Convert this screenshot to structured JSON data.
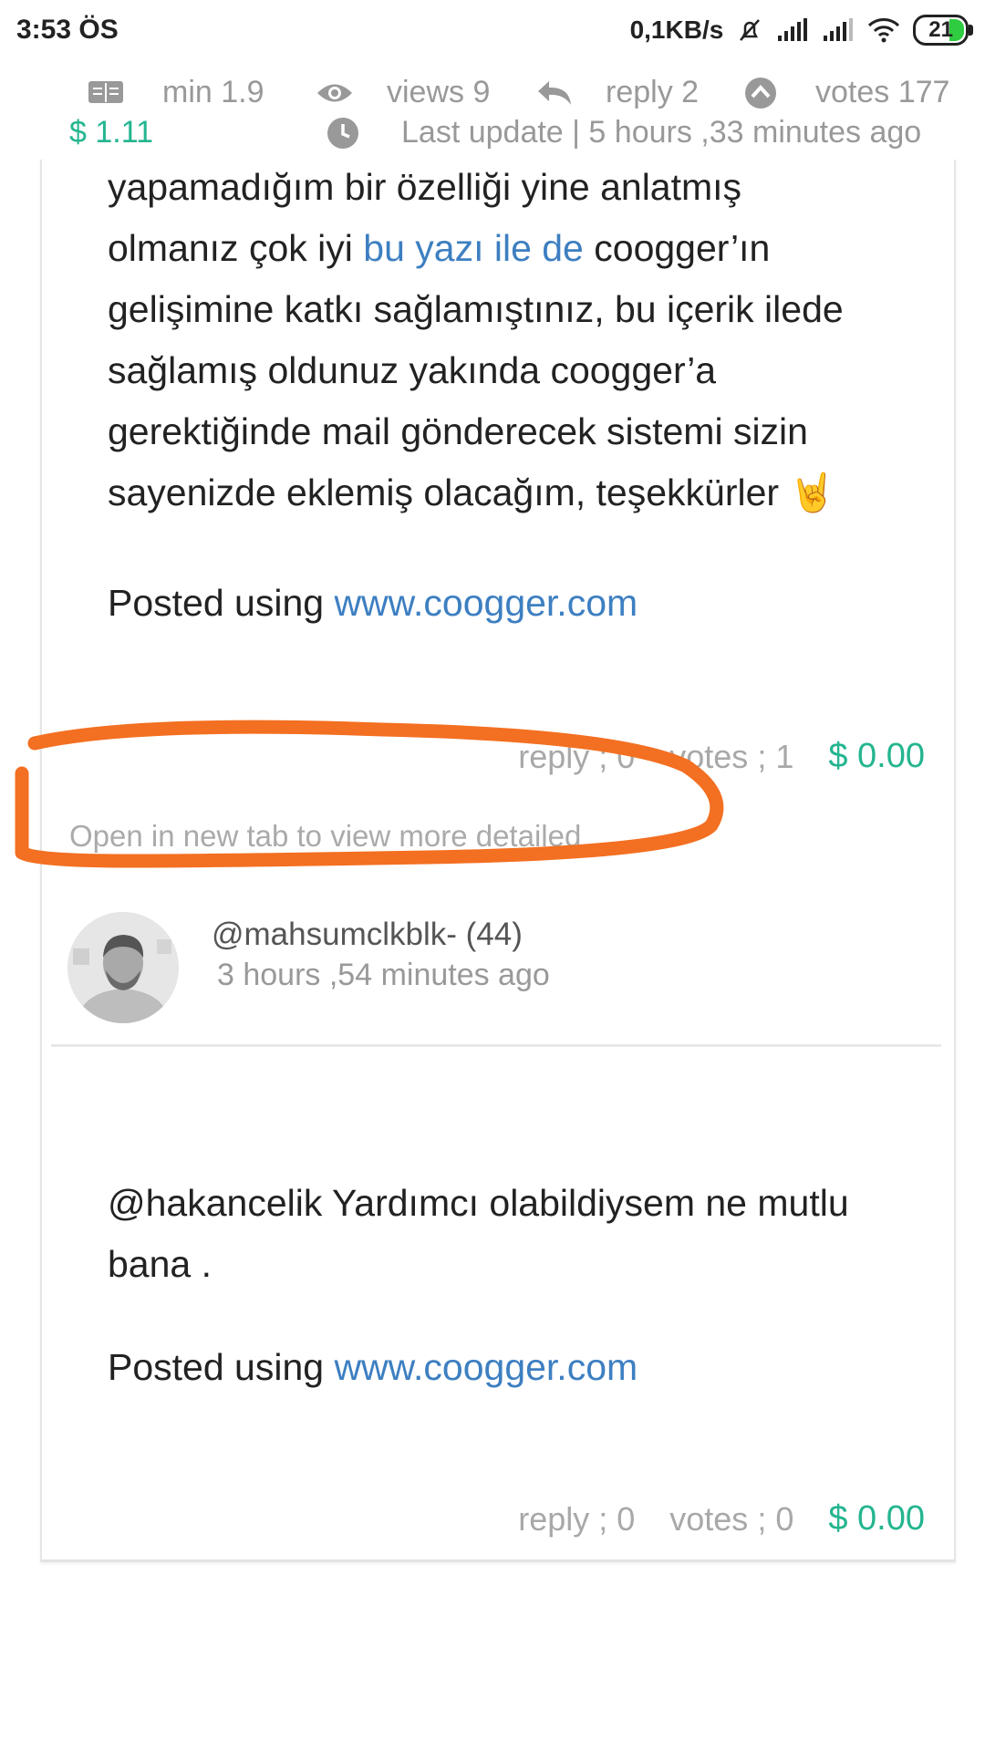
{
  "status_bar": {
    "time": "3:53 ÖS",
    "speed": "0,1KB/s",
    "battery": "21"
  },
  "post_meta": {
    "min": "min 1.9",
    "views": "views 9",
    "reply": "reply 2",
    "votes": "votes 177",
    "payout": "$ 1.11",
    "last_update": "Last update | 5 hours ,33 minutes ago"
  },
  "comment1": {
    "lines": [
      "yapamadığım bir özelliği yine anlatmış",
      "gelişimine katkı sağlamıştınız, bu içerik ilede",
      "sağlamış oldunuz yakında coogger’a",
      "gerektiğinde mail gönderecek sistemi sizin",
      "sayenizde eklemiş olacağım, teşekkürler 🤘"
    ],
    "line2_prefix": "olmanız çok iyi ",
    "line2_link": "bu yazı ile de",
    "line2_suffix": " coogger’ın",
    "posted_using": "Posted using ",
    "posted_link": "www.coogger.com",
    "reply": "reply ; 0",
    "votes": "votes ; 1",
    "payout": "$ 0.00",
    "open_new_tab": "Open in new tab to view more detailed"
  },
  "comment2": {
    "username": "@mahsumclkblk- (44)",
    "time_ago": "3 hours ,54 minutes ago",
    "line1": "@hakancelik Yardımcı olabildiysem ne mutlu",
    "line2": "bana .",
    "posted_using": "Posted using ",
    "posted_link": "www.coogger.com",
    "reply": "reply ; 0",
    "votes": "votes ; 0",
    "payout": "$ 0.00"
  },
  "colors": {
    "link": "#3d7fc1",
    "money": "#24b58f",
    "annotation": "#f36f21"
  }
}
